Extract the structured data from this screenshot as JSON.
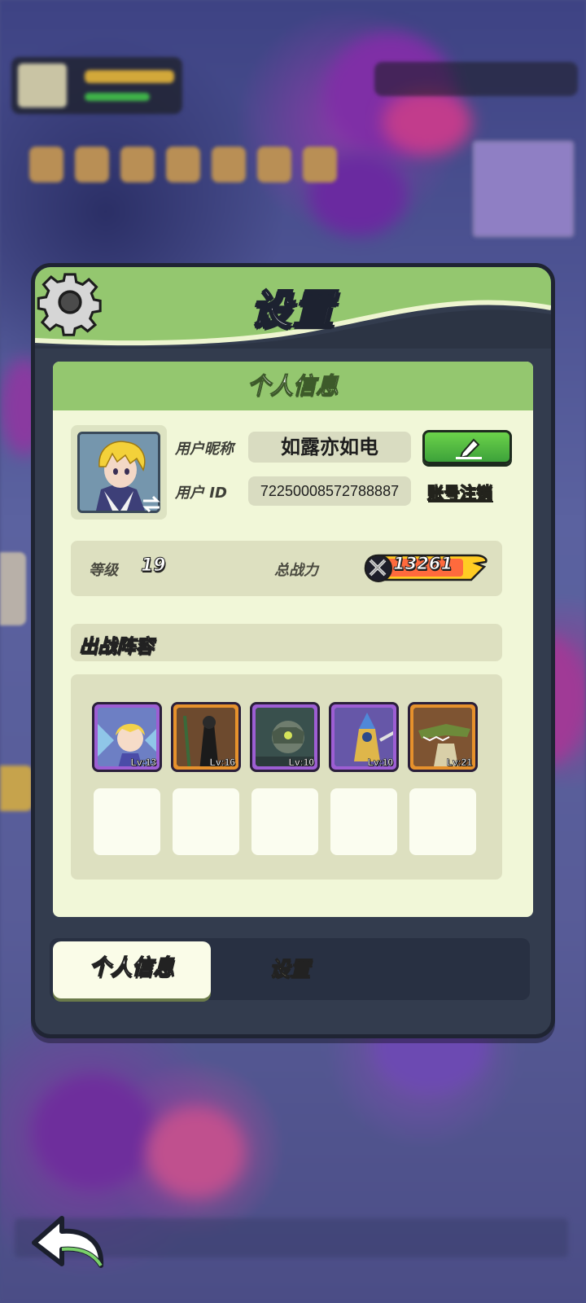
{
  "panel": {
    "title": "设置",
    "header_color": "#94c76f"
  },
  "card": {
    "header": "个人信息"
  },
  "profile": {
    "nickname_label": "用户昵称",
    "nickname": "如露亦如电",
    "id_label": "用户  ID",
    "user_id": "7225000857278888​7",
    "account_cancel": "账号注销",
    "edit_icon": "pencil-icon"
  },
  "stats": {
    "level_label": "等级",
    "level": "19",
    "power_label": "总战力",
    "power": "13261"
  },
  "lineup": {
    "title": "出战阵容",
    "heroes": [
      {
        "level": "Lv:13",
        "rarity_color": "#9d5ed3"
      },
      {
        "level": "Lv:16",
        "rarity_color": "#e6912c"
      },
      {
        "level": "Lv:10",
        "rarity_color": "#9d5ed3"
      },
      {
        "level": "Lv:10",
        "rarity_color": "#9d5ed3"
      },
      {
        "level": "Lv:21",
        "rarity_color": "#e6912c"
      }
    ]
  },
  "tabs": {
    "active": "个人信息",
    "inactive": "设置"
  },
  "icons": {
    "settings": "gear-icon",
    "back": "back-arrow-icon",
    "swap": "swap-icon",
    "power": "crossed-swords-icon"
  }
}
